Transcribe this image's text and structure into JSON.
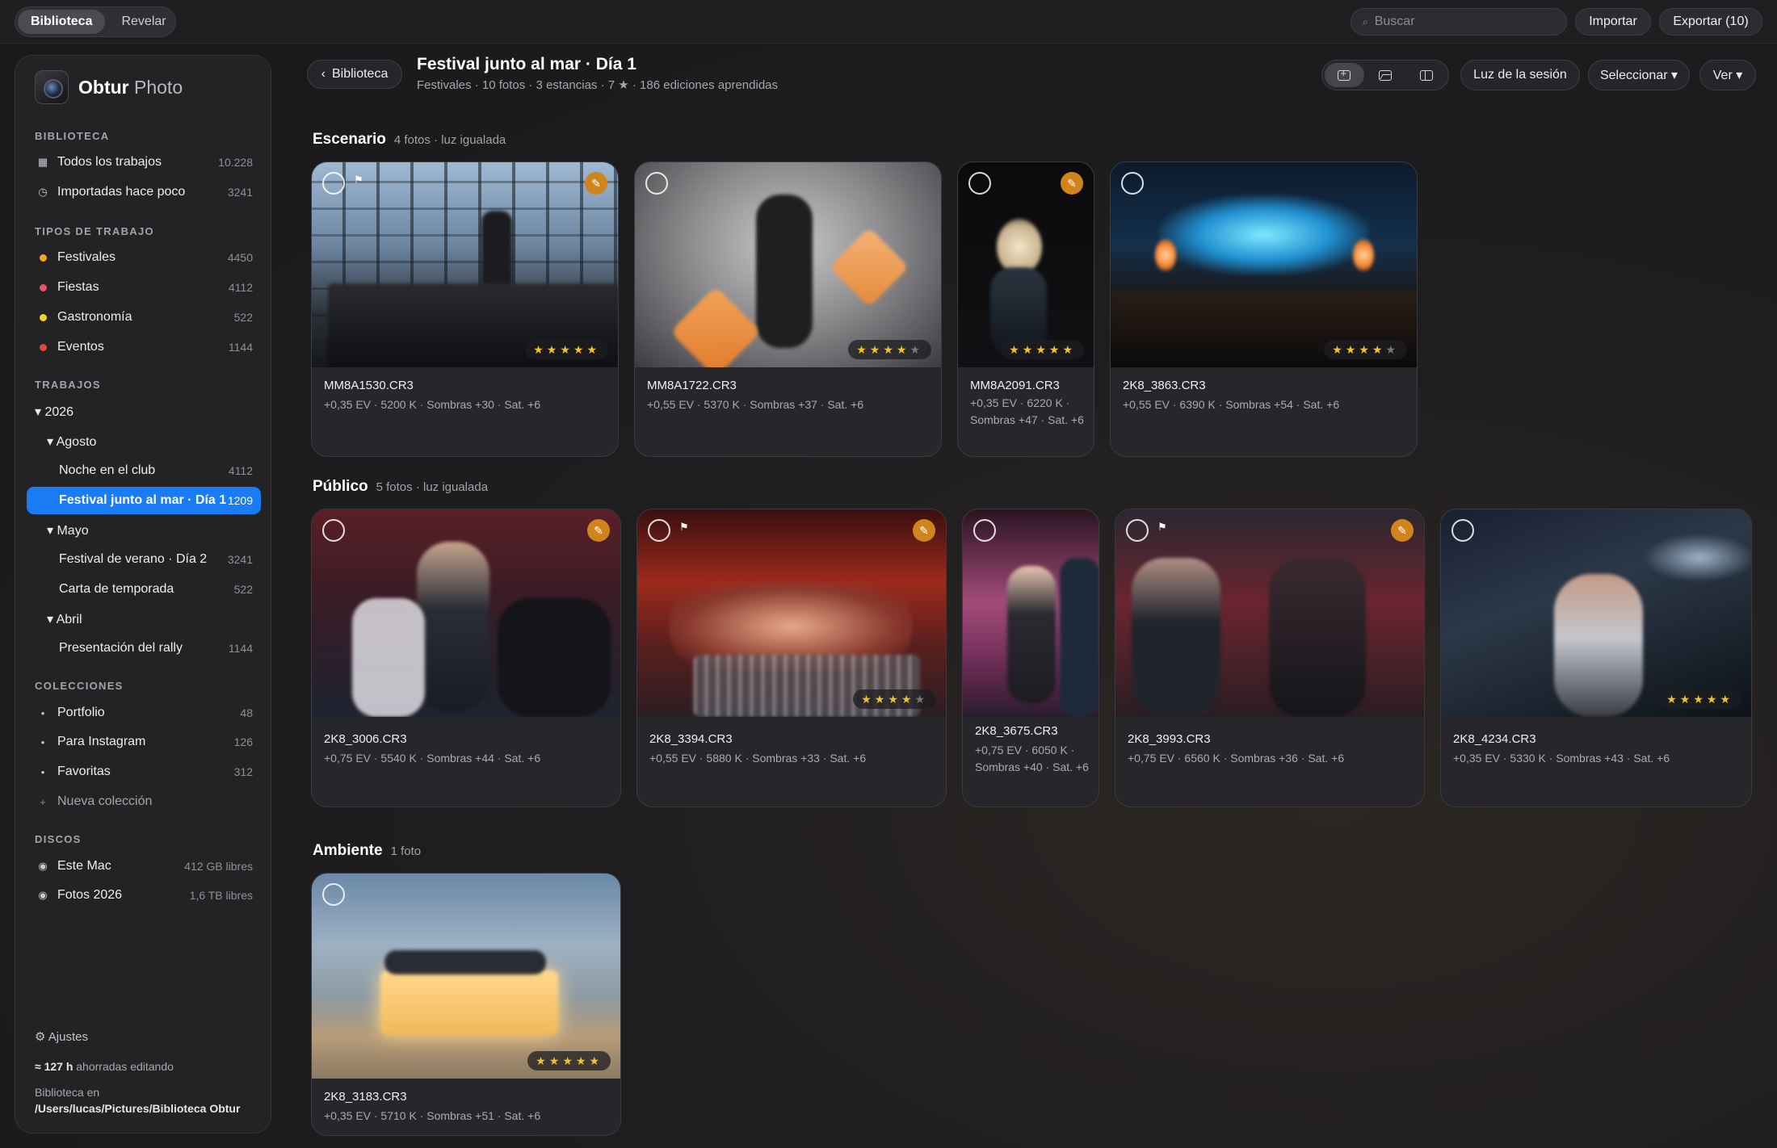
{
  "topbar": {
    "tabs": [
      {
        "label": "Biblioteca",
        "active": true
      },
      {
        "label": "Revelar",
        "active": false
      }
    ],
    "search_placeholder": "Buscar",
    "import_label": "Importar",
    "export_label": "Exportar (10)"
  },
  "sidebar": {
    "app_name_bold": "Obtur",
    "app_name_light": "Photo",
    "library_label": "BIBLIOTECA",
    "library_items": [
      {
        "label": "Todos los trabajos",
        "count": "10.228",
        "icon": "grid-icon"
      },
      {
        "label": "Importadas hace poco",
        "count": "3241",
        "icon": "clock-icon"
      }
    ],
    "types_label": "TIPOS DE TRABAJO",
    "types": [
      {
        "label": "Festivales",
        "count": "4450",
        "color": "#f5a623"
      },
      {
        "label": "Fiestas",
        "count": "4112",
        "color": "#f0506e"
      },
      {
        "label": "Gastronomía",
        "count": "522",
        "color": "#f5d020"
      },
      {
        "label": "Eventos",
        "count": "1144",
        "color": "#e8453c"
      }
    ],
    "jobs_label": "TRABAJOS",
    "jobs": [
      {
        "label": "▾ 2026",
        "count": ""
      },
      {
        "label": "▾ Agosto",
        "count": ""
      },
      {
        "label": "Noche en el club",
        "count": "4112"
      },
      {
        "label": "Festival junto al mar · Día 1",
        "count": "1209",
        "selected": true
      },
      {
        "label": "▾ Mayo",
        "count": ""
      },
      {
        "label": "Festival de verano · Día 2",
        "count": "3241"
      },
      {
        "label": "Carta de temporada",
        "count": "522"
      },
      {
        "label": "▾ Abril",
        "count": ""
      },
      {
        "label": "Presentación del rally",
        "count": "1144"
      }
    ],
    "collections_label": "COLECCIONES",
    "collections": [
      {
        "label": "Portfolio",
        "count": "48"
      },
      {
        "label": "Para Instagram",
        "count": "126"
      },
      {
        "label": "Favoritas",
        "count": "312"
      }
    ],
    "new_collection_label": "Nueva colección",
    "disks_label": "DISCOS",
    "disks": [
      {
        "label": "Este Mac",
        "count": "412 GB libres"
      },
      {
        "label": "Fotos 2026",
        "count": "1,6 TB libres"
      }
    ],
    "settings_label": "Ajustes",
    "saved_hours": "≈ 127 h",
    "saved_text": "ahorradas editando",
    "library_path_label": "Biblioteca en",
    "library_path": "/Users/lucas/Pictures/Biblioteca Obtur"
  },
  "header": {
    "back_label": "Biblioteca",
    "title": "Festival junto al mar · Día 1",
    "subtitle": "Festivales · 10 fotos · 3 estancias · 7 ★ · 186 ediciones aprendidas",
    "session_light_label": "Luz de la sesión",
    "select_label": "Seleccionar ▾",
    "view_label": "Ver ▾"
  },
  "sections": [
    {
      "title": "Escenario",
      "info": "4 fotos · luz igualada",
      "photos": [
        {
          "file": "MM8A1530.CR3",
          "meta": "+0,35 EV · 5200 K · Sombras +30 · Sat. +6",
          "rating": 5,
          "flag": true,
          "edited": true
        },
        {
          "file": "MM8A1722.CR3",
          "meta": "+0,55 EV · 5370 K · Sombras +37 · Sat. +6",
          "rating": 4,
          "flag": false,
          "edited": false
        },
        {
          "file": "MM8A2091.CR3",
          "meta": "+0,35 EV · 6220 K · Sombras +47 · Sat. +6",
          "rating": 5,
          "flag": false,
          "edited": true
        },
        {
          "file": "2K8_3863.CR3",
          "meta": "+0,55 EV · 6390 K · Sombras +54 · Sat. +6",
          "rating": 4,
          "flag": false,
          "edited": false
        }
      ]
    },
    {
      "title": "Público",
      "info": "5 fotos · luz igualada",
      "photos": [
        {
          "file": "2K8_3006.CR3",
          "meta": "+0,75 EV · 5540 K · Sombras +44 · Sat. +6",
          "rating": 0,
          "flag": false,
          "edited": true
        },
        {
          "file": "2K8_3394.CR3",
          "meta": "+0,55 EV · 5880 K · Sombras +33 · Sat. +6",
          "rating": 4,
          "flag": true,
          "edited": true
        },
        {
          "file": "2K8_3675.CR3",
          "meta": "+0,75 EV · 6050 K · Sombras +40 · Sat. +6",
          "rating": 0,
          "flag": false,
          "edited": false
        },
        {
          "file": "2K8_3993.CR3",
          "meta": "+0,75 EV · 6560 K · Sombras +36 · Sat. +6",
          "rating": 0,
          "flag": true,
          "edited": true
        },
        {
          "file": "2K8_4234.CR3",
          "meta": "+0,35 EV · 5330 K · Sombras +43 · Sat. +6",
          "rating": 5,
          "flag": false,
          "edited": false
        }
      ]
    },
    {
      "title": "Ambiente",
      "info": "1 foto",
      "photos": [
        {
          "file": "2K8_3183.CR3",
          "meta": "+0,35 EV · 5710 K · Sombras +51 · Sat. +6",
          "rating": 5,
          "flag": false,
          "edited": false
        }
      ]
    }
  ]
}
